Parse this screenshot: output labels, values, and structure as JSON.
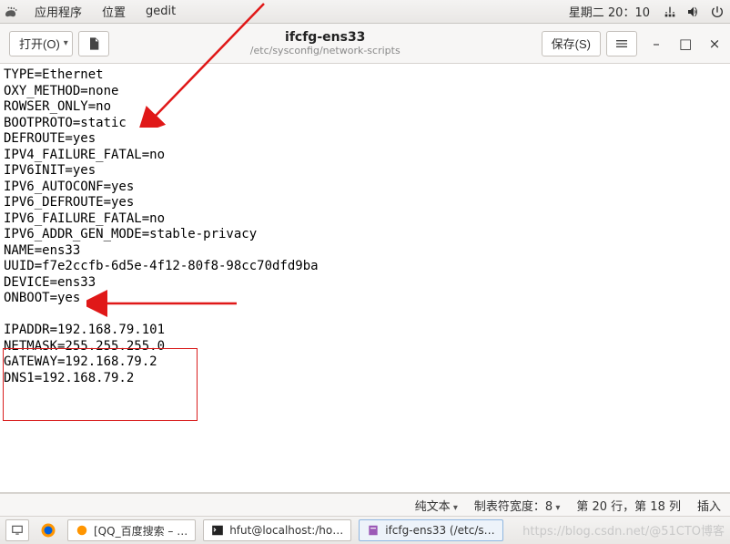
{
  "menubar": {
    "apps": "应用程序",
    "places": "位置",
    "app_name": "gedit",
    "datetime": "星期二 20：10"
  },
  "toolbar": {
    "open_label": "打开(O)",
    "open_caret": "▾",
    "save_label": "保存(S)"
  },
  "title": {
    "filename": "ifcfg-ens33",
    "path": "/etc/sysconfig/network-scripts"
  },
  "editor": {
    "content": "TYPE=Ethernet\nOXY_METHOD=none\nROWSER_ONLY=no\nBOOTPROTO=static\nDEFROUTE=yes\nIPV4_FAILURE_FATAL=no\nIPV6INIT=yes\nIPV6_AUTOCONF=yes\nIPV6_DEFROUTE=yes\nIPV6_FAILURE_FATAL=no\nIPV6_ADDR_GEN_MODE=stable-privacy\nNAME=ens33\nUUID=f7e2ccfb-6d5e-4f12-80f8-98cc70dfd9ba\nDEVICE=ens33\nONBOOT=yes\n\nIPADDR=192.168.79.101\nNETMASK=255.255.255.0\nGATEWAY=192.168.79.2\nDNS1=192.168.79.2"
  },
  "status": {
    "syntax": "纯文本",
    "tabwidth": "制表符宽度：8",
    "position": "第 20 行，第 18 列",
    "mode": "插入"
  },
  "taskbar": {
    "items": [
      {
        "label": "[QQ_百度搜索 – …"
      },
      {
        "label": "hfut@localhost:/ho…"
      },
      {
        "label": "ifcfg-ens33 (/etc/s…"
      }
    ]
  },
  "watermark": "https://blog.csdn.net/@51CTO博客"
}
